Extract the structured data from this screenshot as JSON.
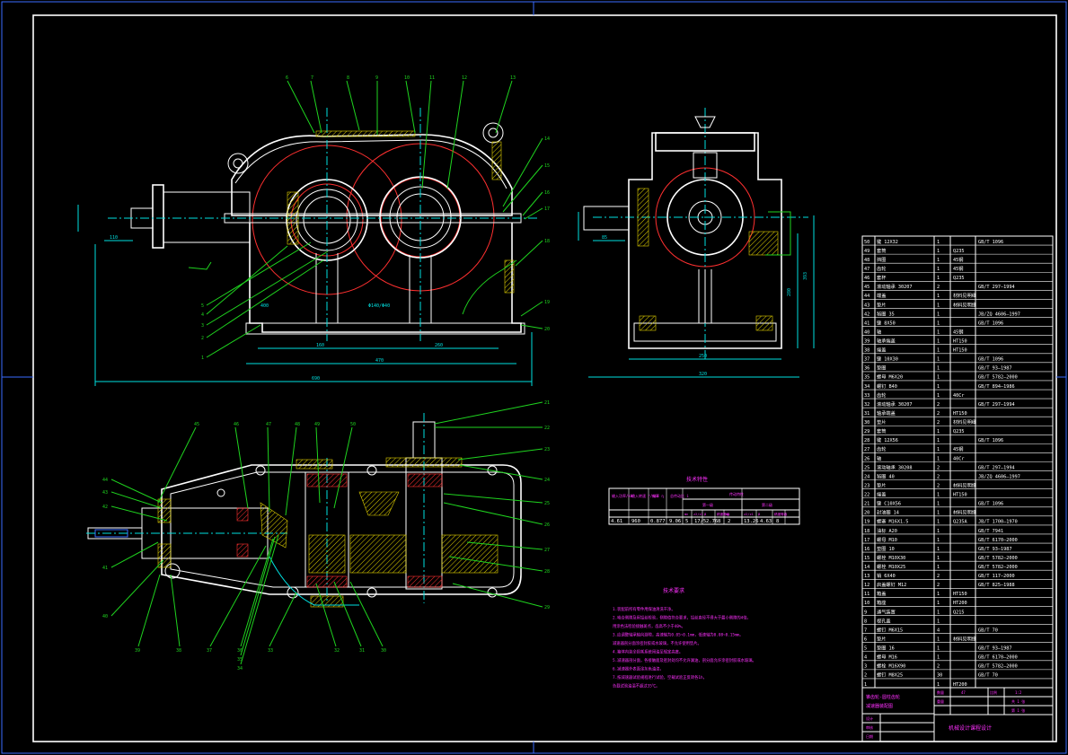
{
  "drawing": {
    "tech_params_title": "技术特性",
    "tech_params_headers": [
      "输入功率/kW",
      "输入转速 r/min",
      "效率 η",
      "总传动比 i",
      "传动特性"
    ],
    "tech_params_subheaders": [
      "第一级",
      "第二级"
    ],
    "tech_params_cols": [
      "mn",
      "z2/z1",
      "β",
      "精度等级",
      "mn",
      "z2/z1",
      "β",
      "精度等级"
    ],
    "tech_params_values": [
      "4.61",
      "960",
      "0.877",
      "9.06",
      "5",
      "17/5",
      "2.76",
      "8",
      "2",
      "13.26",
      "4.63",
      "8"
    ],
    "tech_req_title": "技术要求",
    "tech_req_lines": [
      "1.装配前所有零件用煤油清洗干净。",
      "2.啮合侧隙及用铅丝检验，侧隙值符合要求，铅丝直径不得大于最小侧隙的4倍。",
      "   用涂色法检验接触斑点，齿高不小于40%。",
      "3.应调整轴承轴向游隙，高速轴为0.05~0.1mm，低速轴为0.08~0.15mm。",
      "   减速器剖分面涂密封胶或水玻璃，不允许使用垫片。",
      "4.箱体内装全损耗系统用油至规定高度。",
      "5.减速器剖分面，各接触面及密封处均不允许漏油，剖分面允许涂密封胶或水玻璃。",
      "6.减速器外表面涂灰色油漆。",
      "7.按减速器试验规程进行试验，空载试验正反转各1h，",
      "   负载试验油温不超过35℃。"
    ],
    "title_block": {
      "main_title": "锥齿轮-圆柱齿轮",
      "sub_title": "减速器装配图",
      "scale_label": "比例",
      "scale_value": "1:2",
      "sheet_label": "共 1 张",
      "sheet_no": "第 1 张",
      "weight_label": "重量",
      "qty_label": "数量",
      "qty_value": "47",
      "design_label": "设计",
      "check_label": "审核",
      "date_label": "日期",
      "course_label": "机械设计课程设计"
    },
    "dimension_texts": {
      "front_overall_width": "690",
      "front_centre_span": "470",
      "front_a1": "160",
      "front_a2": "260",
      "front_shaft_h": "110",
      "front_height_dim": "400",
      "front_gear_note": "Φ140/Φ40",
      "side_width": "250",
      "side_total": "320",
      "side_height": "393",
      "side_h2": "280",
      "side_shaft": "85"
    },
    "top_callouts": [
      "6",
      "7",
      "8",
      "9",
      "10",
      "11",
      "12",
      "13",
      "14",
      "15",
      "16",
      "17",
      "18",
      "19",
      "20",
      "1",
      "2",
      "3",
      "4",
      "5"
    ],
    "bottom_callouts": [
      "45",
      "46",
      "47",
      "48",
      "49",
      "50",
      "44",
      "43",
      "42",
      "41",
      "40",
      "39",
      "38",
      "37",
      "36",
      "35",
      "34",
      "33",
      "32",
      "31",
      "30",
      "29",
      "28",
      "27",
      "26",
      "25",
      "24",
      "23",
      "22",
      "21"
    ],
    "bom": [
      {
        "no": "50",
        "name": "键 12X32",
        "qty": "1",
        "mat": "",
        "std": "GB/T 1096"
      },
      {
        "no": "49",
        "name": "套筒",
        "qty": "1",
        "mat": "Q235",
        "std": ""
      },
      {
        "no": "48",
        "name": "挡圈",
        "qty": "1",
        "mat": "45钢",
        "std": ""
      },
      {
        "no": "47",
        "name": "齿轮",
        "qty": "1",
        "mat": "45钢",
        "std": ""
      },
      {
        "no": "46",
        "name": "套杯",
        "qty": "1",
        "mat": "Q235",
        "std": ""
      },
      {
        "no": "45",
        "name": "滚动轴承 30207",
        "qty": "2",
        "mat": "",
        "std": "GB/T 297—1994"
      },
      {
        "no": "44",
        "name": "端盖",
        "qty": "1",
        "mat": "材料见明细",
        "std": ""
      },
      {
        "no": "43",
        "name": "垫片",
        "qty": "1",
        "mat": "材料见明细",
        "std": ""
      },
      {
        "no": "42",
        "name": "毡圈 35",
        "qty": "1",
        "mat": "",
        "std": "JB/ZQ 4606—1997"
      },
      {
        "no": "41",
        "name": "键 8X50",
        "qty": "1",
        "mat": "",
        "std": "GB/T 1096"
      },
      {
        "no": "40",
        "name": "轴",
        "qty": "1",
        "mat": "45钢",
        "std": ""
      },
      {
        "no": "39",
        "name": "轴承端盖",
        "qty": "1",
        "mat": "HT150",
        "std": ""
      },
      {
        "no": "38",
        "name": "端盖",
        "qty": "1",
        "mat": "HT150",
        "std": ""
      },
      {
        "no": "37",
        "name": "键 10X30",
        "qty": "1",
        "mat": "",
        "std": "GB/T 1096"
      },
      {
        "no": "36",
        "name": "垫圈",
        "qty": "1",
        "mat": "",
        "std": "GB/T 93—1987"
      },
      {
        "no": "35",
        "name": "螺母 M6X20",
        "qty": "1",
        "mat": "",
        "std": "GB/T 5782—2000"
      },
      {
        "no": "34",
        "name": "螺钉 B40",
        "qty": "1",
        "mat": "",
        "std": "GB/T 894—1986"
      },
      {
        "no": "33",
        "name": "齿轮",
        "qty": "1",
        "mat": "40Cr",
        "std": ""
      },
      {
        "no": "32",
        "name": "滚动轴承 30207",
        "qty": "2",
        "mat": "",
        "std": "GB/T 297—1994"
      },
      {
        "no": "31",
        "name": "轴承端盖",
        "qty": "2",
        "mat": "HT150",
        "std": ""
      },
      {
        "no": "30",
        "name": "垫片",
        "qty": "2",
        "mat": "材料见明细",
        "std": ""
      },
      {
        "no": "29",
        "name": "套筒",
        "qty": "1",
        "mat": "Q235",
        "std": ""
      },
      {
        "no": "28",
        "name": "键 12X56",
        "qty": "1",
        "mat": "",
        "std": "GB/T 1096"
      },
      {
        "no": "27",
        "name": "齿轮",
        "qty": "1",
        "mat": "45钢",
        "std": ""
      },
      {
        "no": "26",
        "name": "轴",
        "qty": "1",
        "mat": "40Cr",
        "std": ""
      },
      {
        "no": "25",
        "name": "滚动轴承 30208",
        "qty": "2",
        "mat": "",
        "std": "GB/T 297—1994"
      },
      {
        "no": "24",
        "name": "毡圈 40",
        "qty": "2",
        "mat": "",
        "std": "JB/ZQ 4606—1997"
      },
      {
        "no": "23",
        "name": "垫片",
        "qty": "2",
        "mat": "材料见明细",
        "std": ""
      },
      {
        "no": "22",
        "name": "端盖",
        "qty": "1",
        "mat": "HT150",
        "std": ""
      },
      {
        "no": "21",
        "name": "键 C10X56",
        "qty": "1",
        "mat": "",
        "std": "GB/T 1096"
      },
      {
        "no": "20",
        "name": "封油圈 14",
        "qty": "1",
        "mat": "材料见明细",
        "std": ""
      },
      {
        "no": "19",
        "name": "螺塞 M16X1.5",
        "qty": "1",
        "mat": "Q235A",
        "std": "JB/T 1700—1970"
      },
      {
        "no": "18",
        "name": "油标 A20",
        "qty": "1",
        "mat": "",
        "std": "GB/T 7941"
      },
      {
        "no": "17",
        "name": "螺母 M10",
        "qty": "1",
        "mat": "",
        "std": "GB/T 6170—2000"
      },
      {
        "no": "16",
        "name": "垫圈 10",
        "qty": "1",
        "mat": "",
        "std": "GB/T 93—1987"
      },
      {
        "no": "15",
        "name": "螺栓 M10X30",
        "qty": "1",
        "mat": "",
        "std": "GB/T 5782—2000"
      },
      {
        "no": "14",
        "name": "螺栓 M10X25",
        "qty": "1",
        "mat": "",
        "std": "GB/T 5782—2000"
      },
      {
        "no": "13",
        "name": "销 6X40",
        "qty": "2",
        "mat": "",
        "std": "GB/T 117—2000"
      },
      {
        "no": "12",
        "name": "启盖螺钉 M12",
        "qty": "2",
        "mat": "",
        "std": "GB/T 825—1988"
      },
      {
        "no": "11",
        "name": "箱盖",
        "qty": "1",
        "mat": "HT150",
        "std": ""
      },
      {
        "no": "10",
        "name": "箱座",
        "qty": "1",
        "mat": "HT200",
        "std": ""
      },
      {
        "no": "9",
        "name": "通气装置",
        "qty": "1",
        "mat": "Q215",
        "std": ""
      },
      {
        "no": "8",
        "name": "视孔盖",
        "qty": "1",
        "mat": "",
        "std": ""
      },
      {
        "no": "7",
        "name": "螺钉 M6X15",
        "qty": "4",
        "mat": "",
        "std": "GB/T 70"
      },
      {
        "no": "6",
        "name": "垫片",
        "qty": "1",
        "mat": "材料见明细",
        "std": ""
      },
      {
        "no": "5",
        "name": "垫圈 16",
        "qty": "1",
        "mat": "",
        "std": "GB/T 93—1987"
      },
      {
        "no": "4",
        "name": "螺母 M16",
        "qty": "1",
        "mat": "",
        "std": "GB/T 6170—2000"
      },
      {
        "no": "3",
        "name": "螺栓 M16X90",
        "qty": "2",
        "mat": "",
        "std": "GB/T 5782—2000"
      },
      {
        "no": "2",
        "name": "螺钉 M8X25",
        "qty": "30",
        "mat": "",
        "std": "GB/T 70"
      },
      {
        "no": "1",
        "name": "",
        "qty": "1",
        "mat": "HT200",
        "std": ""
      }
    ]
  }
}
